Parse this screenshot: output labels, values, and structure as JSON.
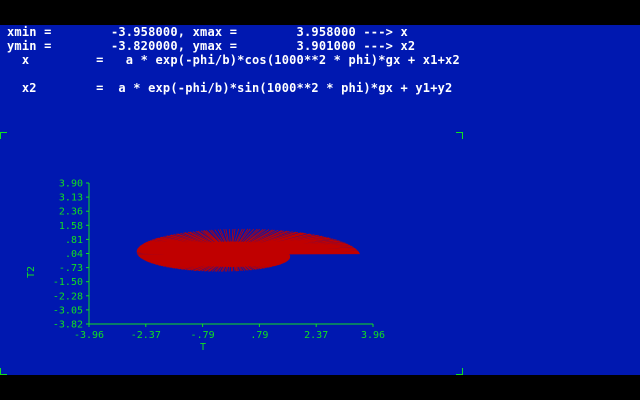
{
  "info": {
    "line1": "xmin =        -3.958000, xmax =        3.958000 ---> x",
    "line2": "ymin =        -3.820000, ymax =        3.901000 ---> x2",
    "line3": "  x         =   a * exp(-phi/b)*cos(1000**2 * phi)*gx + x1+x2",
    "line4": "  x2        =  a * exp(-phi/b)*sin(1000**2 * phi)*gx + y1+y2"
  },
  "colors": {
    "background": "#0018b0",
    "border": "#000000",
    "text": "#ffffff",
    "axis": "#10e020",
    "plot": "#c00000"
  },
  "chart_data": {
    "type": "line",
    "xlabel": "T",
    "ylabel": "T2",
    "xlim": [
      -3.96,
      3.96
    ],
    "ylim": [
      -3.82,
      3.9
    ],
    "x_ticks": [
      "-3.96",
      "-2.37",
      "-.79",
      ".79",
      "2.37",
      "3.96"
    ],
    "y_ticks": [
      "3.90",
      "3.13",
      "2.36",
      "1.58",
      ".81",
      ".04",
      "-.73",
      "-1.50",
      "-2.28",
      "-3.05",
      "-3.82"
    ],
    "series": [
      {
        "x_range": [
          -3.958,
          3.958
        ],
        "y_range": [
          -3.82,
          3.901
        ],
        "formula_x": "a * exp(-phi/b)*cos(1000**2 * phi)*gx + x1+x2",
        "formula_y": "a * exp(-phi/b)*sin(1000**2 * phi)*gx + y1+y2"
      }
    ]
  }
}
